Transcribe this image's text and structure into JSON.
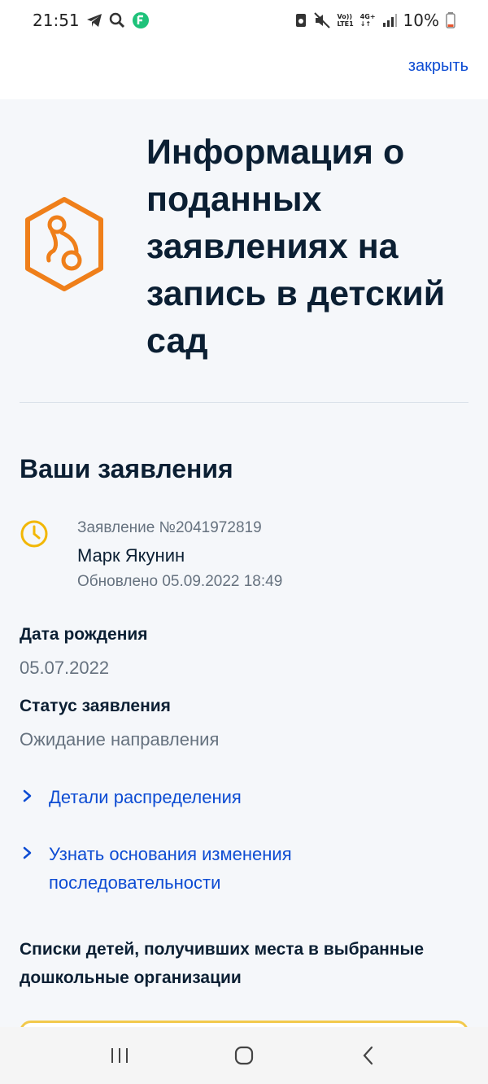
{
  "status_bar": {
    "time": "21:51",
    "volte": [
      "Vo))",
      "LTE1"
    ],
    "network": [
      "4G+",
      "↓↑"
    ],
    "battery": "10%",
    "icons": [
      "telegram-icon",
      "search-icon",
      "app-icon",
      "recycle-icon",
      "mute-icon",
      "signal-icon",
      "battery-icon"
    ]
  },
  "header": {
    "close_label": "закрыть"
  },
  "page": {
    "title": "Информация о поданных заявлениях на запись в детский сад",
    "hero_icon": "pacifier-icon",
    "section_title": "Ваши заявления"
  },
  "application": {
    "number": "Заявление №2041972819",
    "name": "Марк Якунин",
    "updated": "Обновлено 05.09.2022 18:49",
    "status_icon": "clock-icon"
  },
  "details": {
    "birth_label": "Дата рождения",
    "birth_value": "05.07.2022",
    "status_label": "Статус заявления",
    "status_value": "Ожидание направления"
  },
  "links": {
    "distribution": "Детали распределения",
    "order_reasons": "Узнать основания изменения последовательности"
  },
  "lists_title": "Списки детей, получивших места в выбранные дошкольные организации",
  "colors": {
    "accent": "#0d4cd3",
    "hero": "#ef7f1a",
    "clock": "#f2b705",
    "title": "#0b1f33",
    "muted": "#66727f"
  },
  "nav": [
    "recent-apps-icon",
    "home-icon",
    "back-icon"
  ]
}
